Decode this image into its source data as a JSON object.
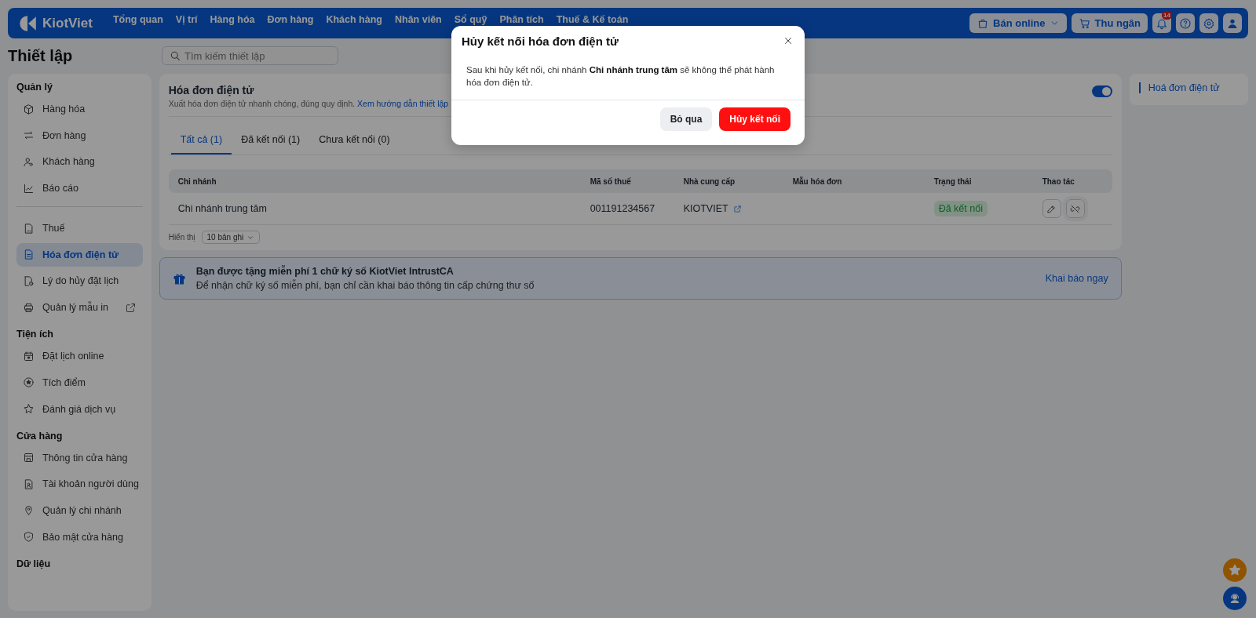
{
  "header": {
    "logo": "KiotViet",
    "menu": [
      "Tổng quan",
      "Vị trí",
      "Hàng hóa",
      "Đơn hàng",
      "Khách hàng",
      "Nhân viên",
      "Sổ quỹ",
      "Phân tích",
      "Thuế & Kế toán"
    ],
    "online_button": "Bán online",
    "cashier_button": "Thu ngân",
    "notification_count": "14"
  },
  "page_title": "Thiết lập",
  "search": {
    "placeholder": "Tìm kiếm thiết lập"
  },
  "sidebar": {
    "sections": [
      {
        "title": "Quản lý",
        "items": [
          {
            "label": "Hàng hóa",
            "selected": false
          },
          {
            "label": "Đơn hàng",
            "selected": false
          },
          {
            "label": "Khách hàng",
            "selected": false
          },
          {
            "label": "Báo cáo",
            "selected": false
          },
          {
            "kind": "divider"
          },
          {
            "label": "Thuế",
            "selected": false
          },
          {
            "label": "Hóa đơn điện tử",
            "selected": true
          },
          {
            "label": "Lý do hủy đặt lịch",
            "selected": false
          },
          {
            "label": "Quản lý mẫu in",
            "selected": false,
            "external": true
          }
        ]
      },
      {
        "title": "Tiện ích",
        "items": [
          {
            "label": "Đặt lịch online",
            "selected": false
          },
          {
            "label": "Tích điểm",
            "selected": false
          },
          {
            "label": "Đánh giá dịch vụ",
            "selected": false
          }
        ]
      },
      {
        "title": "Cửa hàng",
        "items": [
          {
            "label": "Thông tin cửa hàng",
            "selected": false
          },
          {
            "label": "Tài khoản người dùng",
            "selected": false
          },
          {
            "label": "Quản lý chi nhánh",
            "selected": false
          },
          {
            "label": "Bảo mật cửa hàng",
            "selected": false
          }
        ]
      },
      {
        "title": "Dữ liệu"
      }
    ]
  },
  "einvoice": {
    "title": "Hóa đơn điện tử",
    "subtitle": "Xuất hóa đơn điện tử nhanh chóng, đúng quy định.",
    "guide_link": "Xem hướng dẫn thiết lập",
    "enabled": true,
    "tabs": [
      {
        "label": "Tất cả (1)",
        "selected": true
      },
      {
        "label": "Đã kết nối (1)",
        "selected": false
      },
      {
        "label": "Chưa kết nối (0)",
        "selected": false
      }
    ],
    "table": {
      "columns": [
        "Chi nhánh",
        "Mã số thuế",
        "Nhà cung cấp",
        "Mẫu hóa đơn",
        "Trạng thái",
        "Thao tác"
      ],
      "rows": [
        {
          "branch": "Chi nhánh trung tâm",
          "tax_code": "001191234567",
          "provider": "KIOTVIET",
          "status": "Đã kết nối",
          "connected": true
        }
      ]
    },
    "page_size_label": "Hiển thị",
    "page_size": "10 bản ghi"
  },
  "promo": {
    "title": "Bạn được tặng miễn phí 1 chữ ký số KiotViet IntrustCA",
    "text": "Để nhận chữ ký số miễn phí, bạn chỉ cần khai báo thông tin cấp chứng thư số",
    "action": "Khai báo ngay"
  },
  "toc": {
    "items": [
      {
        "label": "Hoá đơn điện tử",
        "selected": true
      }
    ]
  },
  "dialog": {
    "title": "Hủy kết nối hóa đơn điện tử",
    "message": "Sau khi hủy kết nối, chi nhánh **Chi nhánh trung tâm** sẽ không thể phát hành hóa đơn điện tử.",
    "cancel": "Bỏ qua",
    "confirm": "Hủy kết nối"
  }
}
